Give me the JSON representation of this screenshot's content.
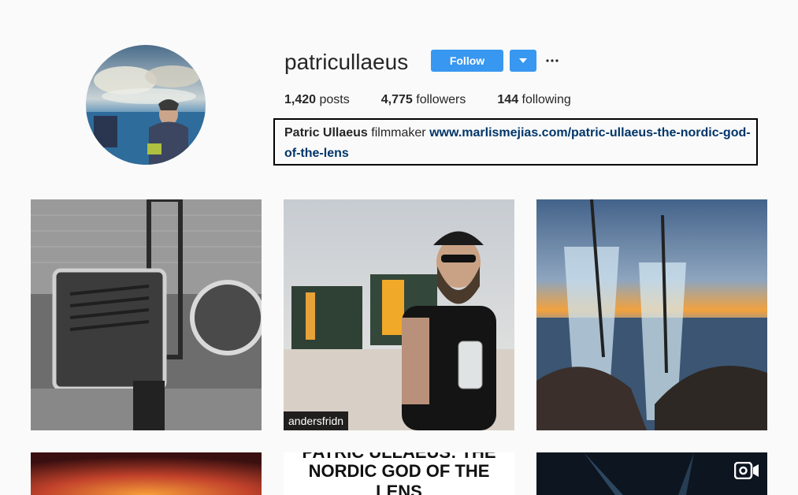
{
  "profile": {
    "username": "patricullaeus",
    "follow_label": "Follow",
    "dropdown_icon": "caret-down-icon",
    "more_icon": "ellipsis-icon",
    "stats": {
      "posts_count": "1,420",
      "posts_label": "posts",
      "followers_count": "4,775",
      "followers_label": "followers",
      "following_count": "144",
      "following_label": "following"
    },
    "bio": {
      "full_name": "Patric Ullaeus",
      "description": "filmmaker",
      "link": "www.marlismejias.com/patric-ullaeus-the-nordic-god-of-the-lens"
    }
  },
  "posts": [
    {
      "overlay": ""
    },
    {
      "overlay": "andersfridn"
    },
    {
      "overlay": ""
    },
    {
      "overlay": ""
    },
    {
      "overlay": "",
      "text_lines": [
        "PATRIC ULLAEUS: THE",
        "NORDIC GOD OF THE",
        "LENS"
      ]
    },
    {
      "overlay": "",
      "badge_icon": "video-camera-icon"
    }
  ],
  "colors": {
    "accent": "#3897f0",
    "link": "#003569",
    "background": "#fafafa"
  }
}
